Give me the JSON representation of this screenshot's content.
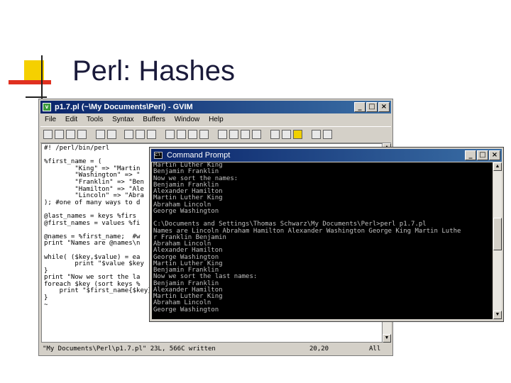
{
  "slide": {
    "title": "Perl: Hashes"
  },
  "colors": {
    "accent_yellow": "#f5d000",
    "accent_red": "#e03020",
    "titlebar_blue": "#0a246a"
  },
  "gvim": {
    "title": "p1.7.pl (~\\My Documents\\Perl) - GVIM",
    "menu": [
      "File",
      "Edit",
      "Tools",
      "Syntax",
      "Buffers",
      "Window",
      "Help"
    ],
    "code": "#! /perl/bin/perl\n\n%first_name = (\n        \"King\" => \"Martin\n        \"Washington\" => \"\n        \"Franklin\" => \"Ben\n        \"Hamilton\" => \"Ale\n        \"Lincoln\" => \"Abra\n); #one of many ways to d\n\n@last_names = keys %firs\n@first_names = values %fi\n\n@names = %first_name;  #w\nprint \"Names are @names\\n\n\nwhile( ($key,$value) = ea\n        print \"$value $key\n}\nprint \"Now we sort the la\nforeach $key (sort keys %\n    print \"$first_name{$key} $key\\n\"\n}\n~\n",
    "status_file": "\"My Documents\\Perl\\p1.7.pl\" 23L, 566C written",
    "status_pos": "20,20",
    "status_all": "All"
  },
  "cmd": {
    "title": "Command Prompt",
    "output": "Martin Luther King\nBenjamin Franklin\nNow we sort the names:\nBenjamin Franklin\nAlexander Hamilton\nMartin Luther King\nAbraham Lincoln\nGeorge Washington\n\nC:\\Documents and Settings\\Thomas Schwarz\\My Documents\\Perl>perl p1.7.pl\nNames are Lincoln Abraham Hamilton Alexander Washington George King Martin Luthe\nr Franklin Benjamin\nAbraham Lincoln\nAlexander Hamilton\nGeorge Washington\nMartin Luther King\nBenjamin Franklin\nNow we sort the last names:\nBenjamin Franklin\nAlexander Hamilton\nMartin Luther King\nAbraham Lincoln\nGeorge Washington\n\nC:\\Documents and Settings\\Thomas Schwarz\\My Documents\\Perl>"
  }
}
